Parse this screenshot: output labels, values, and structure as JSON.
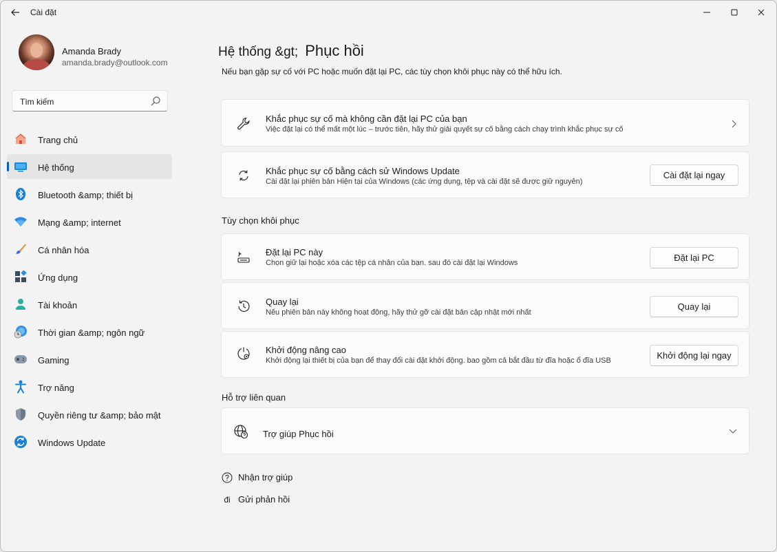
{
  "window": {
    "title": "Cài đặt"
  },
  "profile": {
    "name": "Amanda Brady",
    "email": "amanda.brady@outlook.com"
  },
  "search": {
    "placeholder": "Tìm kiếm"
  },
  "sidebar": {
    "items": [
      {
        "label": "Trang chủ",
        "icon": "home-icon",
        "active": false
      },
      {
        "label": "Hệ thống",
        "icon": "system-display-icon",
        "active": true
      },
      {
        "label": "Bluetooth &amp; thiết bị",
        "icon": "bluetooth-icon",
        "active": false
      },
      {
        "label": "Mạng &amp; internet",
        "icon": "wifi-icon",
        "active": false
      },
      {
        "label": "Cá nhân hóa",
        "icon": "paintbrush-icon",
        "active": false
      },
      {
        "label": "Ứng dụng",
        "icon": "apps-icon",
        "active": false
      },
      {
        "label": "Tài khoản",
        "icon": "account-icon",
        "active": false
      },
      {
        "label": "Thời gian &amp; ngôn ngữ",
        "icon": "globe-clock-icon",
        "active": false
      },
      {
        "label": "Gaming",
        "icon": "gamepad-icon",
        "active": false
      },
      {
        "label": "Trợ năng",
        "icon": "accessibility-icon",
        "active": false
      },
      {
        "label": "Quyền riêng tư &amp; bảo mật",
        "icon": "shield-icon",
        "active": false
      },
      {
        "label": "Windows Update",
        "icon": "windows-update-icon",
        "active": false
      }
    ]
  },
  "header": {
    "parent": "Hệ thống &gt;",
    "current": "Phục hồi",
    "intro": "Nếu bạn gặp sự cố với PC hoặc muốn đặt lại PC, các tùy chọn khôi phục này có thể hữu ích."
  },
  "cards": {
    "troubleshoot": {
      "title": "Khắc phục sự cố mà không cần đặt lại PC của bạn",
      "desc": "Việc đặt lại có thể mất một lúc – trước tiên, hãy thử giải quyết sự cố bằng cách chạy trình khắc phục sự cố"
    },
    "windows_update_fix": {
      "title": "Khắc phục sự cố bằng cách sử Windows Update",
      "desc": "Cài đặt lại phiên bản Hiện tại của Windows (các ứng dụng, tệp và cài đặt sẽ được giữ nguyên)",
      "button": "Cài đặt lại ngay"
    }
  },
  "recovery_options": {
    "section_title": "Tùy chọn khôi phục",
    "reset_pc": {
      "title": "Đặt lại PC này",
      "desc": "Chọn giữ lại hoặc xóa các tệp cá nhân của bạn. sau đó cài đặt lại Windows",
      "button": "Đặt lại PC"
    },
    "go_back": {
      "title": "Quay lại",
      "desc": "Nếu phiên bản này không hoạt động, hãy thử gỡ cài đặt bản cập nhật mới nhất",
      "button": "Quay lại"
    },
    "advanced_startup": {
      "title": "Khởi động nâng cao",
      "desc": "Khởi động lại thiết bị của bạn để thay đổi cài đặt khởi động. bao gồm cả bắt đầu từ đĩa hoặc ổ đĩa USB",
      "button": "Khởi động lại ngay"
    }
  },
  "related_support": {
    "section_title": "Hỗ trợ liên quan",
    "help_recovery": "Trợ giúp Phục hồi"
  },
  "footer": {
    "get_help": "Nhận trợ giúp",
    "feedback_icon_text": "đi",
    "feedback": "Gửi phản hồi"
  }
}
